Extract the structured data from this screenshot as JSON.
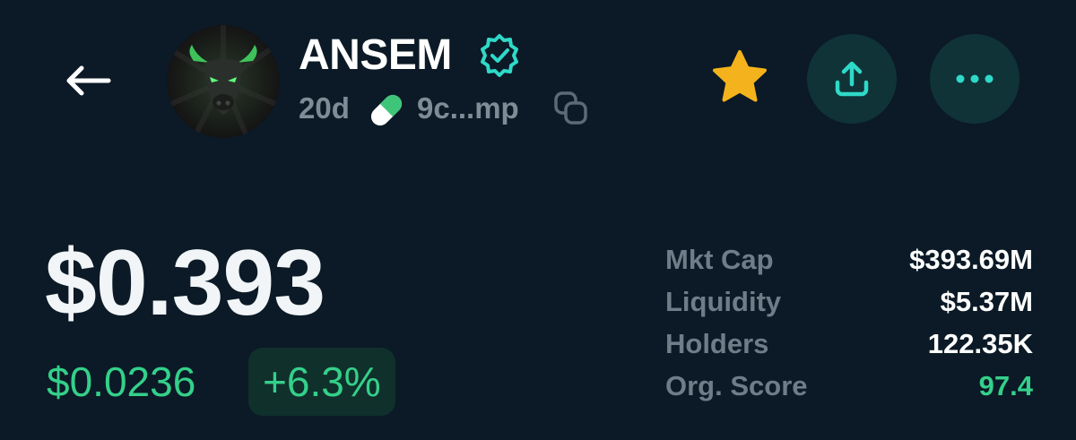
{
  "header": {
    "token_name": "ANSEM",
    "age": "20d",
    "address_short": "9c...mp"
  },
  "icons": {
    "back": "arrow-left-icon",
    "verified": "verified-badge-icon",
    "pill": "pill-icon",
    "copy": "copy-icon",
    "star": "star-icon",
    "share": "share-upload-icon",
    "more": "more-dots-icon"
  },
  "price": {
    "current": "$0.393",
    "change_abs": "$0.0236",
    "change_pct": "+6.3%"
  },
  "stats": [
    {
      "label": "Mkt Cap",
      "value": "$393.69M"
    },
    {
      "label": "Liquidity",
      "value": "$5.37M"
    },
    {
      "label": "Holders",
      "value": "122.35K"
    },
    {
      "label": "Org. Score",
      "value": "97.4"
    }
  ],
  "colors": {
    "background": "#0b1a26",
    "accent_green": "#34d08a",
    "muted_text": "#7f8c96",
    "star": "#f4b31c",
    "teal_icon": "#2fd9c8",
    "button_bg": "#0f3337"
  }
}
